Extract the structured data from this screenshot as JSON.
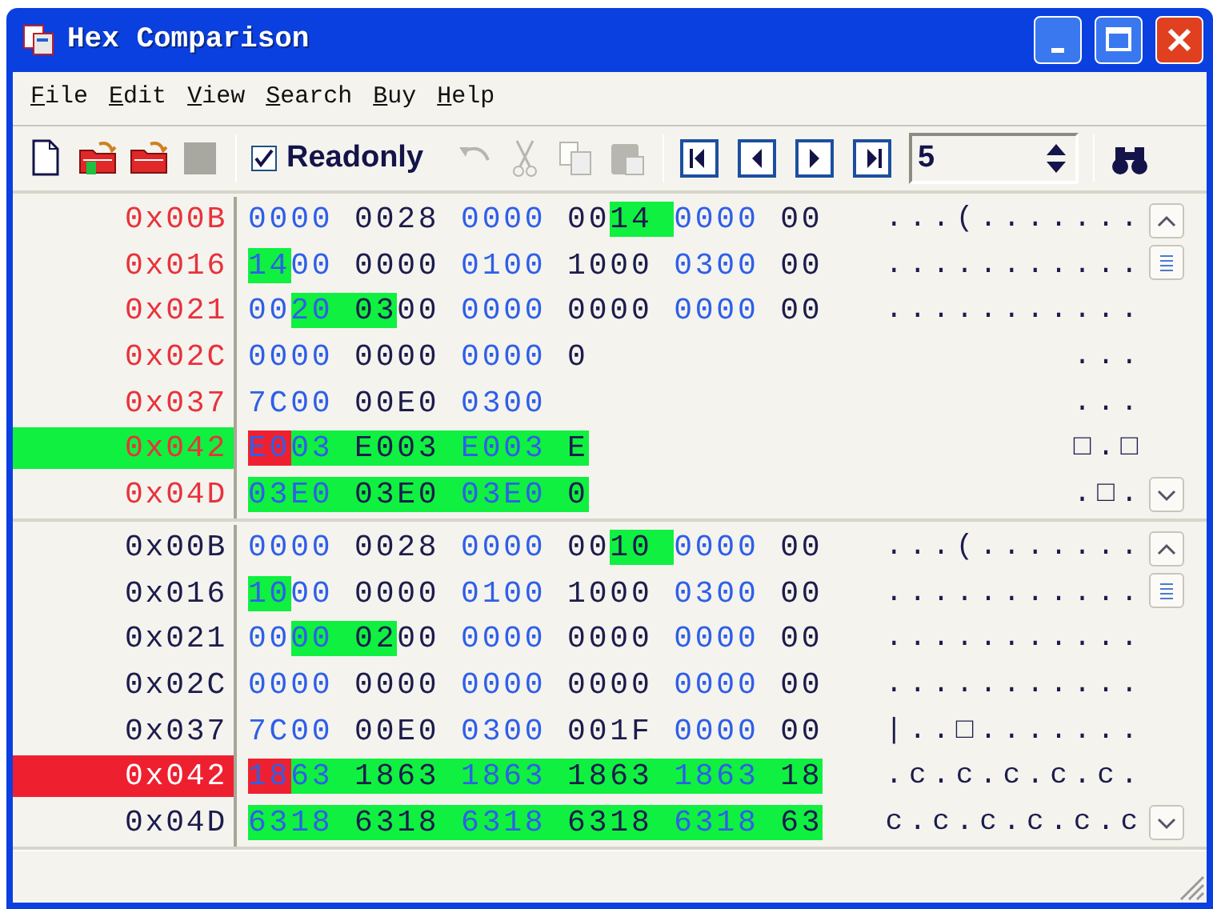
{
  "window": {
    "title": "Hex Comparison"
  },
  "menu": [
    {
      "label": "File"
    },
    {
      "label": "Edit"
    },
    {
      "label": "View"
    },
    {
      "label": "Search"
    },
    {
      "label": "Buy"
    },
    {
      "label": "Help"
    }
  ],
  "toolbar": {
    "left": [
      {
        "kind": "new",
        "disabled": false
      },
      {
        "kind": "open-green"
      },
      {
        "kind": "open-red"
      },
      {
        "kind": "stop",
        "disabled": true
      }
    ],
    "checkbox": {
      "label": "Readonly",
      "checked": true
    },
    "edit": [
      {
        "kind": "undo",
        "disabled": true
      },
      {
        "kind": "cut",
        "disabled": true
      },
      {
        "kind": "copy",
        "disabled": true
      },
      {
        "kind": "paste",
        "disabled": true
      }
    ],
    "nav": [
      {
        "kind": "first"
      },
      {
        "kind": "prev"
      },
      {
        "kind": "next"
      },
      {
        "kind": "last"
      }
    ],
    "spin": {
      "value": "5"
    }
  },
  "panes": [
    {
      "color": "#e8323c",
      "rows": [
        {
          "offset": "0x00B",
          "hex": [
            {
              "text": "0000 0028 0000 00"
            },
            {
              "text": "14 ",
              "kind": "diff"
            },
            {
              "text": "0000 00"
            }
          ],
          "ascii": "...(......."
        },
        {
          "offset": "0x016",
          "hex": [
            {
              "text": "14",
              "kind": "diff"
            },
            {
              "text": "00 0000 0100 1000 0300 00"
            }
          ],
          "ascii": "..........."
        },
        {
          "offset": "0x021",
          "hex": [
            {
              "text": "00"
            },
            {
              "text": "20 03",
              "kind": "diff"
            },
            {
              "text": "00 0000 0000 0000 00"
            }
          ],
          "ascii": "..........."
        },
        {
          "offset": "0x02C",
          "hex": [
            {
              "text": "0000 0000 0000 0"
            }
          ],
          "ascii": "..."
        },
        {
          "offset": "0x037",
          "hex": [
            {
              "text": "7C00 00E0 0300"
            }
          ],
          "ascii": "..."
        },
        {
          "offset": "0x042",
          "kind": "diff",
          "hex": [
            {
              "text": "E0",
              "kind": "cursor"
            },
            {
              "text": "03 E003 E003 E",
              "kind": "diff"
            }
          ],
          "ascii": "□.□"
        },
        {
          "offset": "0x04D",
          "hex": [
            {
              "text": "03E0 03E0 03E0 0",
              "kind": "diff"
            }
          ],
          "ascii": ".□."
        }
      ]
    },
    {
      "color": "#1c1c4c",
      "rows": [
        {
          "offset": "0x00B",
          "hex": [
            {
              "text": "0000 0028 0000 00"
            },
            {
              "text": "10 ",
              "kind": "diff"
            },
            {
              "text": "0000 00"
            }
          ],
          "ascii": "...(......."
        },
        {
          "offset": "0x016",
          "hex": [
            {
              "text": "10",
              "kind": "diff"
            },
            {
              "text": "00 0000 0100 1000 0300 00"
            }
          ],
          "ascii": "..........."
        },
        {
          "offset": "0x021",
          "hex": [
            {
              "text": "00"
            },
            {
              "text": "00 02",
              "kind": "diff"
            },
            {
              "text": "00 0000 0000 0000 00"
            }
          ],
          "ascii": "..........."
        },
        {
          "offset": "0x02C",
          "hex": [
            {
              "text": "0000 0000 0000 0000 0000 00"
            }
          ],
          "ascii": "..........."
        },
        {
          "offset": "0x037",
          "hex": [
            {
              "text": "7C00 00E0 0300 001F 0000 00"
            }
          ],
          "ascii": "|..□......."
        },
        {
          "offset": "0x042",
          "kind": "cursor",
          "hex": [
            {
              "text": "18",
              "kind": "cursor"
            },
            {
              "text": "63 1863 1863 1863 1863 18",
              "kind": "diff"
            }
          ],
          "ascii": ".c.c.c.c.c."
        },
        {
          "offset": "0x04D",
          "hex": [
            {
              "text": "6318 6318 6318 6318 6318 63",
              "kind": "diff"
            }
          ],
          "ascii": "c.c.c.c.c.c"
        }
      ]
    }
  ]
}
